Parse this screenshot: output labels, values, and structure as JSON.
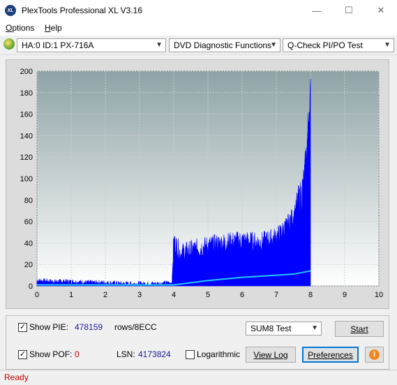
{
  "window": {
    "icon_text": "XL",
    "title": "PlexTools Professional XL V3.16",
    "minimize_glyph": "—",
    "maximize_glyph": "☐",
    "close_glyph": "✕"
  },
  "menu": {
    "options_first": "O",
    "options_rest": "ptions",
    "help_first": "H",
    "help_rest": "elp"
  },
  "toolbar": {
    "drive_icon": "disc-icon",
    "drive": "HA:0 ID:1  PX-716A",
    "function": "DVD Diagnostic Functions",
    "test": "Q-Check PI/PO Test"
  },
  "chart_data": {
    "type": "area",
    "x_ticks": [
      "0",
      "1",
      "2",
      "3",
      "4",
      "5",
      "6",
      "7",
      "8",
      "9",
      "10"
    ],
    "y_ticks": [
      "0",
      "20",
      "40",
      "60",
      "80",
      "100",
      "120",
      "140",
      "160",
      "180",
      "200"
    ],
    "xlim": [
      0,
      10
    ],
    "ylim": [
      0,
      200
    ],
    "grid": true,
    "series": [
      {
        "color": "#0000ff",
        "x": [
          0,
          0.5,
          1,
          1.5,
          2,
          2.5,
          3,
          3.5,
          3.95,
          4.0,
          4.2,
          4.5,
          5,
          5.5,
          6,
          6.5,
          7,
          7.3,
          7.5,
          7.7,
          7.8,
          7.85,
          7.9,
          7.95,
          8.0
        ],
        "values": [
          5,
          4,
          4,
          3,
          3,
          2,
          2,
          2,
          3,
          42,
          30,
          33,
          37,
          40,
          42,
          40,
          45,
          55,
          65,
          80,
          95,
          110,
          130,
          160,
          178
        ]
      },
      {
        "color": "#22ccff",
        "x": [
          0,
          1,
          2,
          3,
          3.9,
          4.0,
          5,
          6,
          7,
          7.5,
          8.0
        ],
        "values": [
          1,
          1,
          1,
          1,
          1,
          1,
          5,
          8,
          10,
          11,
          14
        ]
      }
    ]
  },
  "controls": {
    "show_pie_label": "Show PIE:",
    "show_pie_checked": "✓",
    "pie_value": "478159",
    "pie_unit": "rows/8ECC",
    "show_pof_label": "Show POF:",
    "show_pof_checked": "✓",
    "pof_value": "0",
    "lsn_label": "LSN:",
    "lsn_value": "4173824",
    "logarithmic_label": "Logarithmic",
    "sum_select": "SUM8 Test",
    "start_button": "Start",
    "view_log_button": "View Log",
    "preferences_button": "Preferences",
    "info_icon": "info-icon"
  },
  "status": {
    "text": "Ready"
  }
}
